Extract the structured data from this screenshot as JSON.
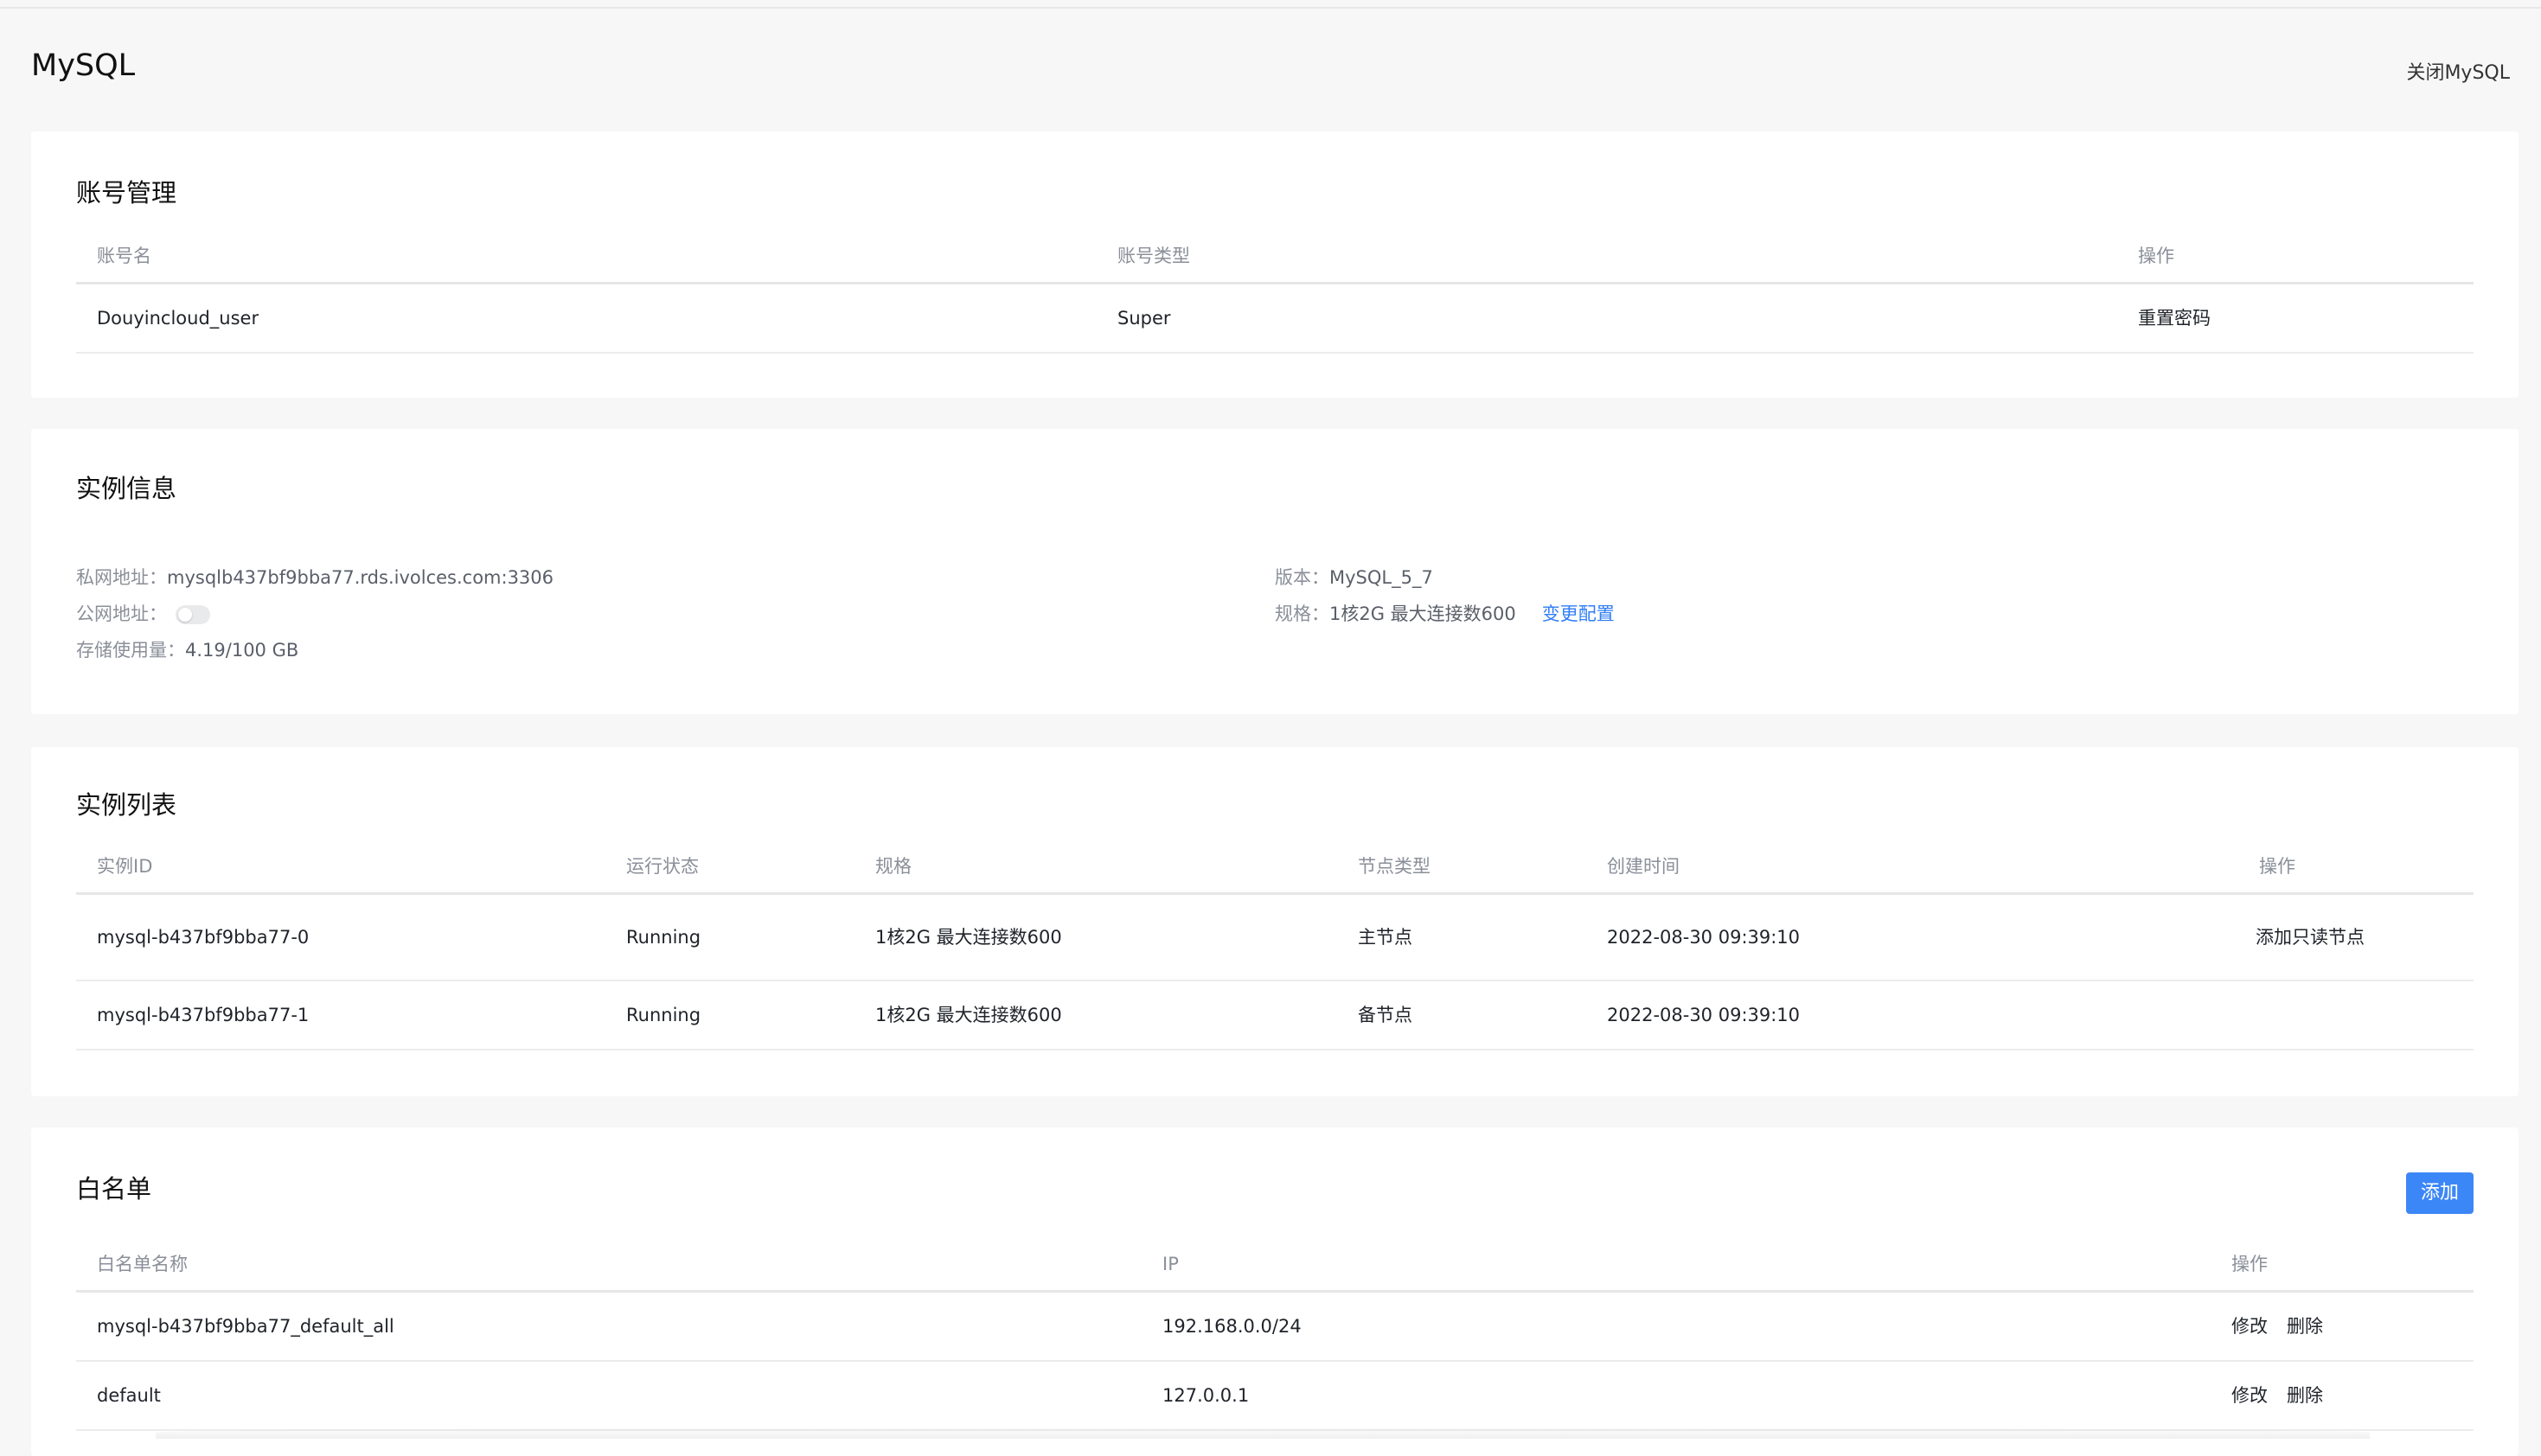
{
  "header": {
    "title": "MySQL",
    "close_label": "关闭MySQL"
  },
  "accounts": {
    "title": "账号管理",
    "columns": [
      "账号名",
      "账号类型",
      "操作"
    ],
    "rows": [
      {
        "name": "Douyincloud_user",
        "type": "Super",
        "action": "重置密码"
      }
    ]
  },
  "instance_info": {
    "title": "实例信息",
    "private_label": "私网地址：",
    "private_value": "mysqlb437bf9bba77.rds.ivolces.com:3306",
    "public_label": "公网地址：",
    "public_enabled": false,
    "storage_label": "存储使用量：",
    "storage_value": "4.19/100 GB",
    "version_label": "版本：",
    "version_value": "MySQL_5_7",
    "spec_label": "规格：",
    "spec_value": "1核2G 最大连接数600",
    "change_label": "变更配置"
  },
  "instances": {
    "title": "实例列表",
    "columns": [
      "实例ID",
      "运行状态",
      "规格",
      "节点类型",
      "创建时间",
      "操作"
    ],
    "rows": [
      {
        "id": "mysql-b437bf9bba77-0",
        "status": "Running",
        "spec": "1核2G 最大连接数600",
        "node": "主节点",
        "created": "2022-08-30 09:39:10",
        "action": "添加只读节点"
      },
      {
        "id": "mysql-b437bf9bba77-1",
        "status": "Running",
        "spec": "1核2G 最大连接数600",
        "node": "备节点",
        "created": "2022-08-30 09:39:10",
        "action": ""
      }
    ]
  },
  "whitelist": {
    "title": "白名单",
    "add_label": "添加",
    "columns": [
      "白名单名称",
      "IP",
      "操作"
    ],
    "rows": [
      {
        "name": "mysql-b437bf9bba77_default_all",
        "ip": "192.168.0.0/24",
        "edit": "修改",
        "delete": "删除"
      },
      {
        "name": "default",
        "ip": "127.0.0.1",
        "edit": "修改",
        "delete": "删除"
      }
    ]
  },
  "colors": {
    "accent": "#2f7df6",
    "primary_button": "#3c87f7",
    "danger": "#e5484d",
    "background": "#f7f7f7"
  }
}
